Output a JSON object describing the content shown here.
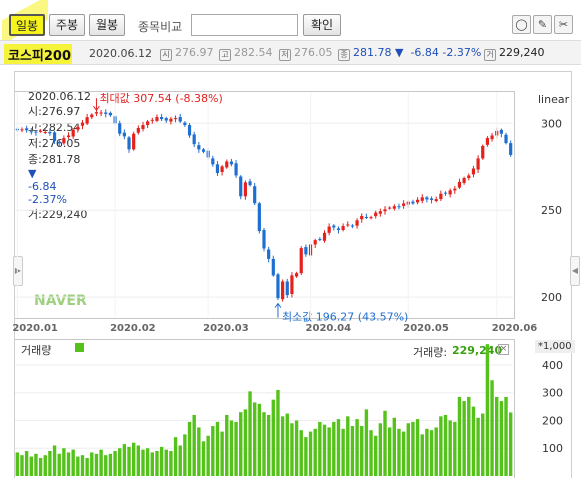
{
  "toolbar": {
    "period_buttons": [
      "일봉",
      "주봉",
      "월봉"
    ],
    "compare_label": "종목비교",
    "compare_input_value": "",
    "confirm_label": "확인"
  },
  "quote": {
    "name": "코스피200",
    "date": "2020.06.12",
    "open_icon": "시",
    "open": "276.97",
    "high_icon": "고",
    "high": "282.54",
    "low_icon": "저",
    "low": "276.05",
    "close_icon": "종",
    "close": "281.78",
    "change": "▼  -6.84 -2.37%",
    "volume_icon": "거",
    "volume": "229,240"
  },
  "chart_header": {
    "date": "2020.06.12",
    "open_label": "시:",
    "open": "276.97",
    "high_label": "고:",
    "high": "282.54",
    "low_label": "저:",
    "low": "276.05",
    "close_label": "종:",
    "close": "281.78",
    "arrow": "▼",
    "change": "-6.84",
    "pct": "-2.37%",
    "vol_label": "거:",
    "volume": "229,240"
  },
  "price_panel": {
    "scale_label": "linear",
    "watermark": "NAVER",
    "max_annotation": "최대값 307.54 (-8.38%)",
    "min_annotation": "최소값 196.27 (43.57%)"
  },
  "volume_panel": {
    "title": "거래량",
    "legend_label": "거래량:",
    "legend_value": "229,240",
    "unit": "*1,000"
  },
  "colors": {
    "up": "#e5211e",
    "down": "#1f6fd1",
    "volume": "#55c21b",
    "highlight": "#f6f21b"
  },
  "chart_data": [
    {
      "type": "candlestick",
      "x_tick_labels": [
        "2020.01",
        "2020.02",
        "2020.03",
        "2020.04",
        "2020.05",
        "2020.06"
      ],
      "y_ticks": [
        200,
        250,
        300
      ],
      "ylim": [
        188,
        318
      ],
      "scale": "linear",
      "max": {
        "value": 307.54,
        "note": "(-8.38%)"
      },
      "min": {
        "value": 196.27,
        "note": "(43.57%)"
      },
      "close": [
        296,
        296.5,
        296,
        295.2,
        294.8,
        295.5,
        295,
        294.2,
        289.8,
        288.5,
        291.5,
        293,
        296.4,
        298,
        300.4,
        303.5,
        305,
        306.4,
        306.2,
        305.4,
        304.6,
        300,
        294,
        292.5,
        285,
        294,
        297.3,
        299,
        301.1,
        302,
        303.6,
        302.4,
        301.6,
        302.6,
        303,
        301,
        299,
        293,
        288,
        285,
        283.6,
        280.4,
        276.4,
        271.4,
        275.2,
        278,
        276.4,
        270,
        258,
        266,
        264.4,
        254,
        238,
        228,
        222,
        212.5,
        199.4,
        209,
        201.2,
        212.5,
        213.8,
        228.2,
        224.6,
        230.3,
        232.8,
        233,
        237,
        240.6,
        240.1,
        238.6,
        240.9,
        241.8,
        241.1,
        244.2,
        246.7,
        245.8,
        246,
        248.6,
        249.4,
        250.5,
        251.5,
        252.3,
        251.9,
        253.9,
        254.9,
        253.9,
        256,
        257.4,
        256.2,
        255.9,
        256.4,
        259.5,
        259.7,
        261.4,
        262.4,
        266.3,
        268.5,
        270,
        274,
        279.8,
        287,
        291.5,
        293,
        295.6,
        294,
        288.6,
        281.78
      ],
      "volume_y_ticks": [
        100,
        200,
        300,
        400
      ],
      "volume_ylim": [
        0,
        490
      ],
      "volume_unit": "*1,000",
      "volume": [
        85,
        75,
        90,
        70,
        80,
        65,
        75,
        90,
        110,
        80,
        100,
        85,
        95,
        70,
        75,
        65,
        85,
        80,
        95,
        75,
        80,
        90,
        100,
        115,
        105,
        120,
        110,
        95,
        100,
        85,
        90,
        105,
        95,
        90,
        140,
        110,
        150,
        195,
        220,
        175,
        125,
        145,
        180,
        195,
        160,
        220,
        200,
        195,
        230,
        240,
        305,
        265,
        260,
        230,
        220,
        275,
        310,
        215,
        225,
        190,
        200,
        165,
        140,
        160,
        170,
        195,
        185,
        175,
        195,
        205,
        170,
        215,
        180,
        205,
        180,
        240,
        165,
        145,
        190,
        235,
        175,
        210,
        170,
        160,
        190,
        195,
        205,
        150,
        170,
        165,
        175,
        215,
        220,
        200,
        195,
        285,
        270,
        285,
        250,
        210,
        225,
        475,
        345,
        285,
        270,
        285,
        229
      ]
    }
  ]
}
